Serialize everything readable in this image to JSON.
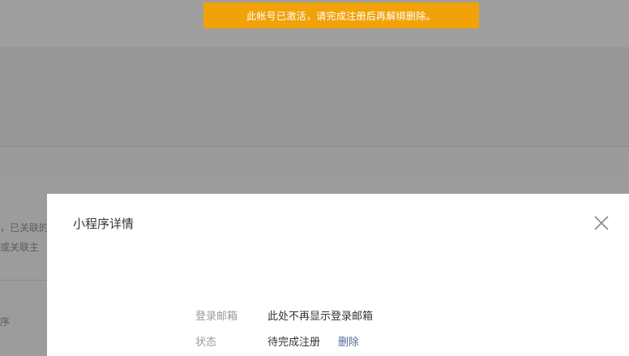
{
  "notice": {
    "text": "此帐号已激活，请完成注册后再解绑删除。",
    "color": "#f0a208"
  },
  "background": {
    "text_line1": "，已关联的",
    "text_line2": "或关联主",
    "text_item": "序"
  },
  "dialog": {
    "title": "小程序详情",
    "close_icon": "close-icon",
    "fields": [
      {
        "label": "登录邮箱",
        "value": "此处不再显示登录邮箱"
      },
      {
        "label": "状态",
        "value": "待完成注册",
        "action": "删除"
      }
    ],
    "link_color": "#576b95"
  }
}
